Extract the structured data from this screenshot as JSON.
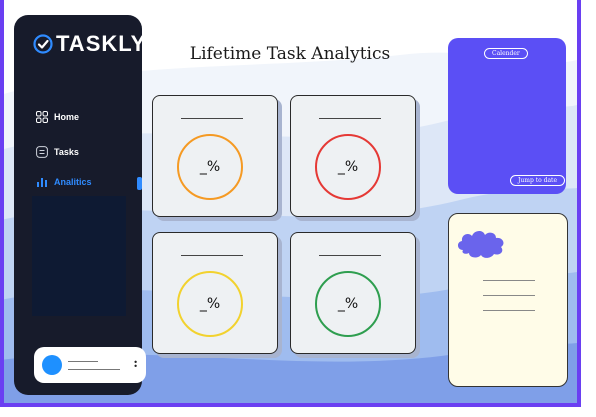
{
  "app": {
    "logo_text": "TASKLY"
  },
  "sidebar": {
    "items": [
      {
        "label": "Home",
        "icon": "grid-icon",
        "active": false
      },
      {
        "label": "Tasks",
        "icon": "tasks-icon",
        "active": false
      },
      {
        "label": "Analitics",
        "icon": "bar-chart-icon",
        "active": true
      }
    ]
  },
  "main": {
    "title": "Lifetime Task Analytics",
    "stats": [
      {
        "value": "_%",
        "color": "#f59a23"
      },
      {
        "value": "_%",
        "color": "#e53935"
      },
      {
        "value": "_%",
        "color": "#f2d22e"
      },
      {
        "value": "_%",
        "color": "#2e9e4f"
      }
    ]
  },
  "calendar": {
    "title": "Calender",
    "jump_label": "Jump to date"
  },
  "colors": {
    "accent": "#5b4ff5",
    "frame": "#6a3ff2",
    "sidebar_bg": "#171b2b",
    "active_nav": "#2f8bff"
  }
}
